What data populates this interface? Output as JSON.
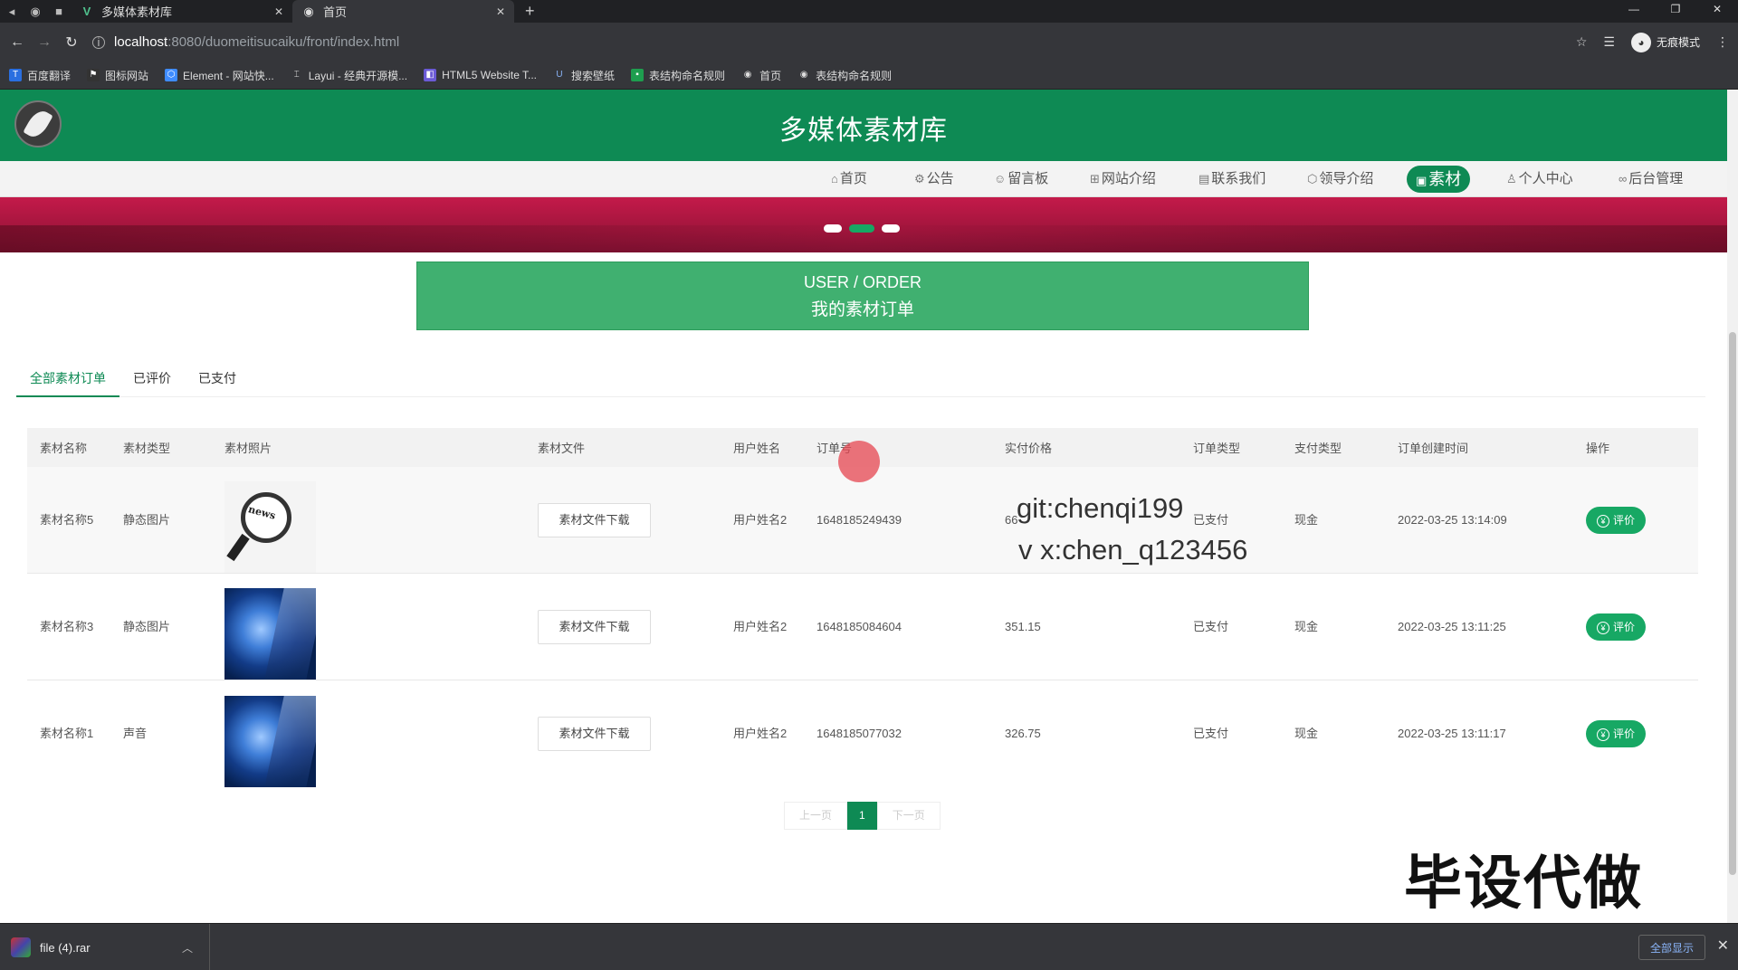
{
  "browser": {
    "tabs": [
      {
        "title": "多媒体素材库",
        "active": false
      },
      {
        "title": "首页",
        "active": true
      }
    ],
    "url_host": "localhost",
    "url_path": ":8080/duomeitisucaiku/front/index.html",
    "profile_label": "无痕模式",
    "bookmarks": [
      {
        "label": "百度翻译"
      },
      {
        "label": "图标网站"
      },
      {
        "label": "Element - 网站快..."
      },
      {
        "label": "Layui - 经典开源模..."
      },
      {
        "label": "HTML5 Website T..."
      },
      {
        "label": "搜索壁纸"
      },
      {
        "label": "表结构命名规则"
      },
      {
        "label": "首页"
      },
      {
        "label": "表结构命名规则"
      }
    ]
  },
  "site": {
    "title": "多媒体素材库",
    "nav": [
      {
        "label": "首页",
        "icon": "home-icon"
      },
      {
        "label": "公告",
        "icon": "gear-icon"
      },
      {
        "label": "留言板",
        "icon": "chat-icon"
      },
      {
        "label": "网站介绍",
        "icon": "grid-icon"
      },
      {
        "label": "联系我们",
        "icon": "doc-icon"
      },
      {
        "label": "领导介绍",
        "icon": "cube-icon"
      },
      {
        "label": "素材",
        "icon": "media-icon",
        "active": true
      },
      {
        "label": "个人中心",
        "icon": "user-icon"
      },
      {
        "label": "后台管理",
        "icon": "link-icon"
      }
    ]
  },
  "order_box": {
    "en": "USER / ORDER",
    "cn": "我的素材订单"
  },
  "filter_tabs": [
    {
      "label": "全部素材订单",
      "active": true
    },
    {
      "label": "已评价"
    },
    {
      "label": "已支付"
    }
  ],
  "table": {
    "headers": [
      "素材名称",
      "素材类型",
      "素材照片",
      "素材文件",
      "用户姓名",
      "订单号",
      "实付价格",
      "订单类型",
      "支付类型",
      "订单创建时间",
      "操作"
    ],
    "rows": [
      {
        "name": "素材名称5",
        "type": "静态图片",
        "photo": "news",
        "file_btn": "素材文件下载",
        "user": "用户姓名2",
        "order_no": "1648185249439",
        "price": "66",
        "order_type": "已支付",
        "pay_type": "现金",
        "created": "2022-03-25 13:14:09",
        "action": "评价"
      },
      {
        "name": "素材名称3",
        "type": "静态图片",
        "photo": "globe",
        "file_btn": "素材文件下载",
        "user": "用户姓名2",
        "order_no": "1648185084604",
        "price": "351.15",
        "order_type": "已支付",
        "pay_type": "现金",
        "created": "2022-03-25 13:11:25",
        "action": "评价"
      },
      {
        "name": "素材名称1",
        "type": "声音",
        "photo": "globe",
        "file_btn": "素材文件下载",
        "user": "用户姓名2",
        "order_no": "1648185077032",
        "price": "326.75",
        "order_type": "已支付",
        "pay_type": "现金",
        "created": "2022-03-25 13:11:17",
        "action": "评价"
      }
    ]
  },
  "pager": {
    "prev": "上一页",
    "current": "1",
    "next": "下一页"
  },
  "overlay": {
    "line1": "git:chenqi199",
    "line2": "v x:chen_q123456",
    "big": "毕设代做"
  },
  "download_bar": {
    "file": "file (4).rar",
    "show_all": "全部显示"
  },
  "colors": {
    "brand_green": "#0e8a54",
    "button_green": "#17a864",
    "title_box": "#40b070",
    "banner": "#b0174a"
  }
}
